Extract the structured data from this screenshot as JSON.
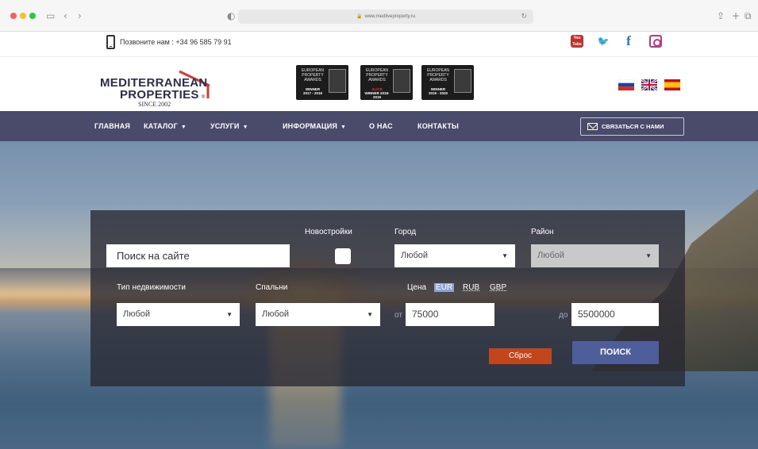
{
  "browser": {
    "url": "www.medliveproperty.ru",
    "colors": {
      "close": "#ff5f57",
      "minimize": "#febc2e",
      "maximize": "#28c840"
    }
  },
  "topbar": {
    "phone_text": "Позвоните нам : +34 96 585 79 91",
    "social": {
      "youtube_label": "You Tube",
      "twitter_label": "🐦",
      "facebook_label": "f"
    }
  },
  "header": {
    "logo": {
      "line1": "MEDITERRANEAN",
      "line2": "PROPERTIES",
      "line3": "SINCE 2002",
      "registered": "®"
    },
    "awards": [
      {
        "text": "EUROPEAN PROPERTY AWARDS",
        "winner": "WINNER",
        "years": "2017 - 2018"
      },
      {
        "text": "EUROPEAN PROPERTY AWARDS",
        "winner": "ALICE",
        "years": "WINNER 2018-2019"
      },
      {
        "text": "EUROPEAN PROPERTY AWARDS",
        "winner": "WINNER",
        "years": "2019 - 2020"
      }
    ],
    "languages": [
      "ru-flag",
      "uk-flag",
      "es-flag"
    ]
  },
  "nav": {
    "items": [
      {
        "label": "ГЛАВНАЯ",
        "dropdown": false
      },
      {
        "label": "КАТАЛОГ",
        "dropdown": true
      },
      {
        "label": "УСЛУГИ",
        "dropdown": true
      },
      {
        "label": "ИНФОРМАЦИЯ",
        "dropdown": true
      },
      {
        "label": "О НАС",
        "dropdown": false
      },
      {
        "label": "КОНТАКТЫ",
        "dropdown": false
      }
    ],
    "dropdown_glyph": "▼",
    "contact_button": "СВЯЗАТЬСЯ С НАМИ",
    "background": "#4a4a6b"
  },
  "search": {
    "site_search_placeholder": "Поиск на сайте",
    "new_builds_label": "Новостройки",
    "city_label": "Город",
    "city_value": "Любой",
    "district_label": "Район",
    "district_value": "Любой",
    "property_type_label": "Тип недвижимости",
    "property_type_value": "Любой",
    "bedrooms_label": "Спальни",
    "bedrooms_value": "Любой",
    "price_label": "Цена",
    "currencies": [
      "EUR",
      "RUB",
      "GBP"
    ],
    "active_currency": "EUR",
    "from_prefix": "от",
    "price_from": "75000",
    "to_prefix": "до",
    "price_to": "5500000",
    "reset_button": "Сброс",
    "search_button": "ПОИСК",
    "colors": {
      "reset": "#c3461b",
      "search": "#4d5e9a",
      "active_currency": "#8ea3d6"
    }
  }
}
